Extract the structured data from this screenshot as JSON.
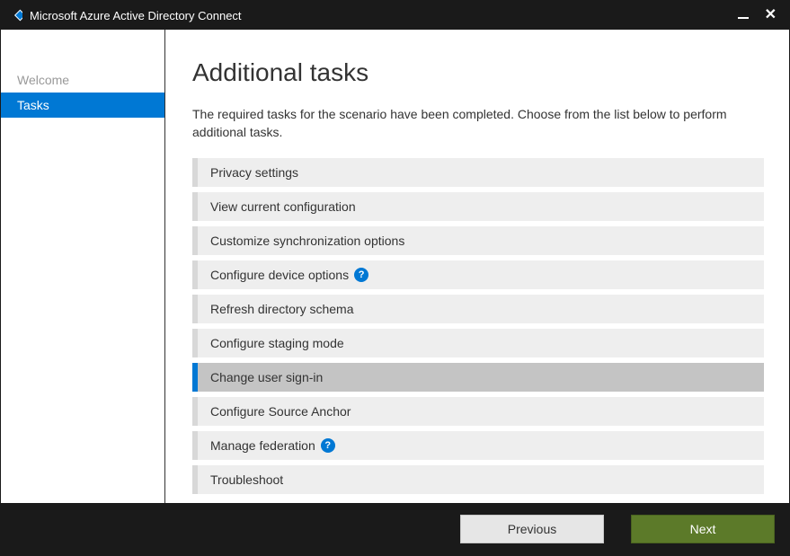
{
  "window": {
    "title": "Microsoft Azure Active Directory Connect"
  },
  "sidebar": {
    "items": [
      {
        "label": "Welcome",
        "active": false
      },
      {
        "label": "Tasks",
        "active": true
      }
    ]
  },
  "main": {
    "title": "Additional tasks",
    "description": "The required tasks for the scenario have been completed. Choose from the list below to perform additional tasks.",
    "tasks": [
      {
        "label": "Privacy settings",
        "help": false,
        "selected": false
      },
      {
        "label": "View current configuration",
        "help": false,
        "selected": false
      },
      {
        "label": "Customize synchronization options",
        "help": false,
        "selected": false
      },
      {
        "label": "Configure device options",
        "help": true,
        "selected": false
      },
      {
        "label": "Refresh directory schema",
        "help": false,
        "selected": false
      },
      {
        "label": "Configure staging mode",
        "help": false,
        "selected": false
      },
      {
        "label": "Change user sign-in",
        "help": false,
        "selected": true
      },
      {
        "label": "Configure Source Anchor",
        "help": false,
        "selected": false
      },
      {
        "label": "Manage federation",
        "help": true,
        "selected": false
      },
      {
        "label": "Troubleshoot",
        "help": false,
        "selected": false
      }
    ]
  },
  "footer": {
    "previous_label": "Previous",
    "next_label": "Next"
  }
}
